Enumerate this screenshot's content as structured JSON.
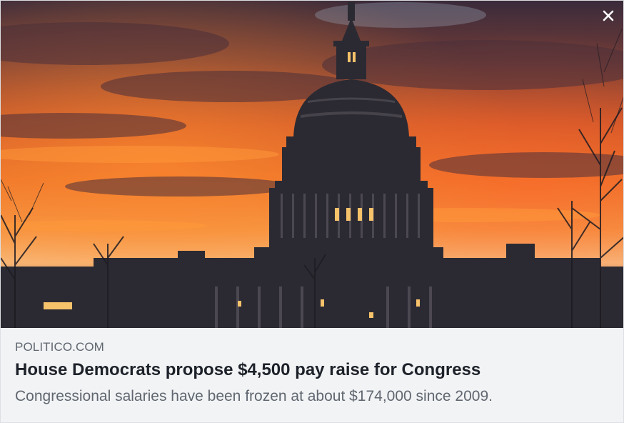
{
  "link_card": {
    "domain": "POLITICO.COM",
    "headline": "House Democrats propose $4,500 pay raise for Congress",
    "description": "Congressional salaries have been frozen at about $174,000 since 2009."
  },
  "icons": {
    "close": "close-icon"
  },
  "colors": {
    "card_background": "#f2f3f5",
    "headline_text": "#1d2129",
    "secondary_text": "#606770",
    "sky_orange": "#f0641e",
    "dusk_purple": "#3b2a3a"
  }
}
